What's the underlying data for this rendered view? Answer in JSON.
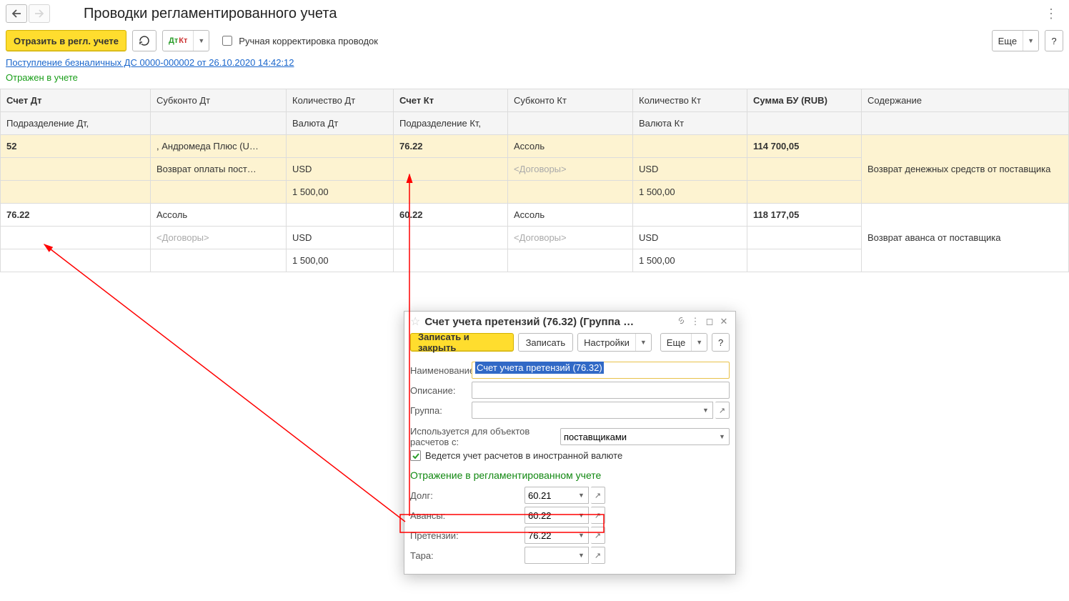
{
  "header": {
    "title": "Проводки регламентированного учета",
    "more_label": "Еще"
  },
  "toolbar": {
    "reflect": "Отразить в регл. учете",
    "manual_label": "Ручная корректировка проводок"
  },
  "doc_link": "Поступление безналичных ДС 0000-000002 от 26.10.2020 14:42:12",
  "status": "Отражен в учете",
  "hdr": {
    "acc_dt": "Счет Дт",
    "sub_dt": "Субконто Дт",
    "qty_dt": "Количество Дт",
    "acc_kt": "Счет Кт",
    "sub_kt": "Субконто Кт",
    "qty_kt": "Количество Кт",
    "sum": "Сумма БУ (RUB)",
    "content": "Содержание",
    "dep_dt": "Подразделение Дт,",
    "cur_dt": "Валюта Дт",
    "dep_kt": "Подразделение Кт,",
    "cur_kt": "Валюта Кт"
  },
  "rows": [
    {
      "acc_dt": "52",
      "sub_dt1": ", Андромеда Плюс (U…",
      "sub_dt2": "Возврат оплаты пост…",
      "cur_dt": "USD",
      "qty_dt": "1 500,00",
      "acc_kt": "76.22",
      "sub_kt1": "Ассоль",
      "sub_kt2": "<Договоры>",
      "cur_kt": "USD",
      "qty_kt": "1 500,00",
      "sum": "114 700,05",
      "content": "Возврат денежных средств от поставщика",
      "highlight": true
    },
    {
      "acc_dt": "76.22",
      "sub_dt1": "Ассоль",
      "sub_dt2": "<Договоры>",
      "cur_dt": "USD",
      "qty_dt": "1 500,00",
      "acc_kt": "60.22",
      "sub_kt1": "Ассоль",
      "sub_kt2": "<Договоры>",
      "cur_kt": "USD",
      "qty_kt": "1 500,00",
      "sum": "118 177,05",
      "content": "Возврат аванса от поставщика",
      "highlight": false
    }
  ],
  "popup": {
    "title": "Счет учета претензий (76.32) (Группа …",
    "save_close": "Записать и закрыть",
    "save": "Записать",
    "settings": "Настройки",
    "more": "Еще",
    "help": "?",
    "name_label": "Наименование:",
    "name_value": "Счет учета претензий (76.32)",
    "desc_label": "Описание:",
    "group_label": "Группа:",
    "used_label": "Используется для объектов расчетов с:",
    "used_value": "поставщиками",
    "foreign_label": "Ведется учет расчетов в иностранной валюте",
    "section": "Отражение в регламентированном учете",
    "debt_label": "Долг:",
    "debt_value": "60.21",
    "advance_label": "Авансы:",
    "advance_value": "60.22",
    "claims_label": "Претензии:",
    "claims_value": "76.22",
    "tara_label": "Тара:",
    "tara_value": ""
  }
}
